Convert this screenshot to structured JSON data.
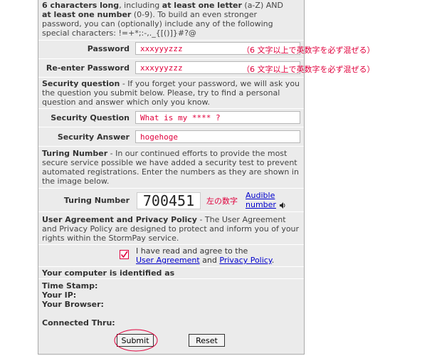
{
  "intro": {
    "line1_plain": "6 characters long",
    "line1_mid": ", including ",
    "line1_bold": "at least one letter",
    "line1_tail": " (a-Z) AND",
    "line2_bold": "at least one number",
    "line2_tail": " (0-9). To build an even stronger",
    "line3": "password, you can (optionally) include any of the following",
    "line4": "special characters: !=+*;:-,._{[()]}#?@"
  },
  "password": {
    "label": "Password",
    "value": "xxxyyyzzz",
    "annotation": "（6 文字以上で英数字を必ず混ぜる）"
  },
  "reenter": {
    "label": "Re-enter Password",
    "value": "xxxyyyzzz",
    "annotation": "（6 文字以上で英数字を必ず混ぜる）"
  },
  "security": {
    "heading": "Security question",
    "desc": " - If you forget your password, we will ask you the question you submit below. Please, try to find a personal question and answer which only you know.",
    "question_label": "Security Question",
    "question_value": "What is my **** ?",
    "answer_label": "Security Answer",
    "answer_value": "hogehoge"
  },
  "turing": {
    "heading": "Turing Number",
    "desc": " - In our continued efforts to provide the most secure service possible we have added a security test to prevent automated registrations. Enter the numbers as they are shown in the image below.",
    "label": "Turing Number",
    "captcha_text": "700451",
    "annotation": "左の数字",
    "audible_link": "Audible number",
    "speaker_icon": "speaker-icon"
  },
  "agreement": {
    "heading": "User Agreement and Privacy Policy",
    "desc": " - The User Agreement and Privacy Policy are designed to protect and inform you of your rights within the StormPay service.",
    "checkbox_text": "I have read and agree to the",
    "link1": "User Agreement",
    "and": " and ",
    "link2": "Privacy Policy",
    "period": "."
  },
  "computer": {
    "heading": "Your computer is identified as",
    "time_stamp": "Time Stamp:",
    "ip": "Your IP:",
    "browser": "Your Browser:",
    "connected": "Connected Thru:"
  },
  "buttons": {
    "submit": "Submit",
    "reset": "Reset"
  },
  "colors": {
    "annotation_red": "#e0003c",
    "panel_bg": "#ebebeb",
    "link_blue": "#0000cc"
  }
}
